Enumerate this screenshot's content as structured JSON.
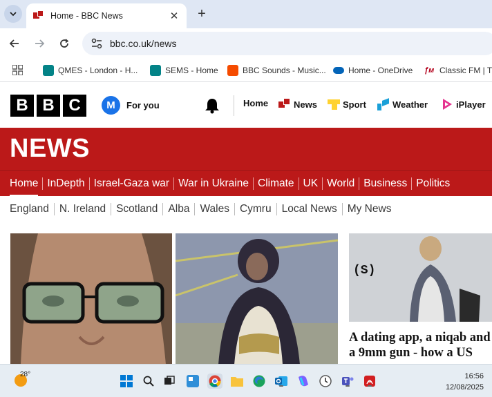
{
  "browser": {
    "tab": {
      "title": "Home - BBC News",
      "close_glyph": "✕"
    },
    "new_tab_glyph": "+",
    "address": "bbc.co.uk/news",
    "bookmarks": [
      {
        "label": "QMES - London - H...",
        "icon": "sharepoint-icon",
        "color": "#038387"
      },
      {
        "label": "SEMS - Home",
        "icon": "sharepoint-icon",
        "color": "#038387"
      },
      {
        "label": "BBC Sounds - Music...",
        "icon": "bbc-sounds-icon",
        "color": "#f54b00"
      },
      {
        "label": "Home - OneDrive",
        "icon": "onedrive-icon",
        "color": "#0364b8"
      },
      {
        "label": "Classic FM | Th",
        "icon": "classic-fm-icon",
        "color": "#b3001b"
      }
    ]
  },
  "bbc": {
    "logo": [
      "B",
      "B",
      "C"
    ],
    "for_you": {
      "initial": "M",
      "label": "For you"
    },
    "top_nav": [
      {
        "label": "Home",
        "icon": ""
      },
      {
        "label": "News",
        "icon": "news-icon"
      },
      {
        "label": "Sport",
        "icon": "sport-icon"
      },
      {
        "label": "Weather",
        "icon": "weather-icon"
      },
      {
        "label": "iPlayer",
        "icon": "iplayer-icon"
      }
    ],
    "section_title": "NEWS",
    "news_nav": [
      "Home",
      "InDepth",
      "Israel-Gaza war",
      "War in Ukraine",
      "Climate",
      "UK",
      "World",
      "Business",
      "Politics"
    ],
    "news_nav_active": "Home",
    "sub_nav": [
      "England",
      "N. Ireland",
      "Scotland",
      "Alba",
      "Wales",
      "Cymru",
      "Local News",
      "My News"
    ],
    "featured_headline": "A dating app, a niqab and a 9mm gun - how a US"
  },
  "taskbar": {
    "temperature": "28°",
    "time": "16:56",
    "date": "12/08/2025"
  },
  "colors": {
    "bbc_red": "#bb1919",
    "brand_black": "#000000"
  }
}
